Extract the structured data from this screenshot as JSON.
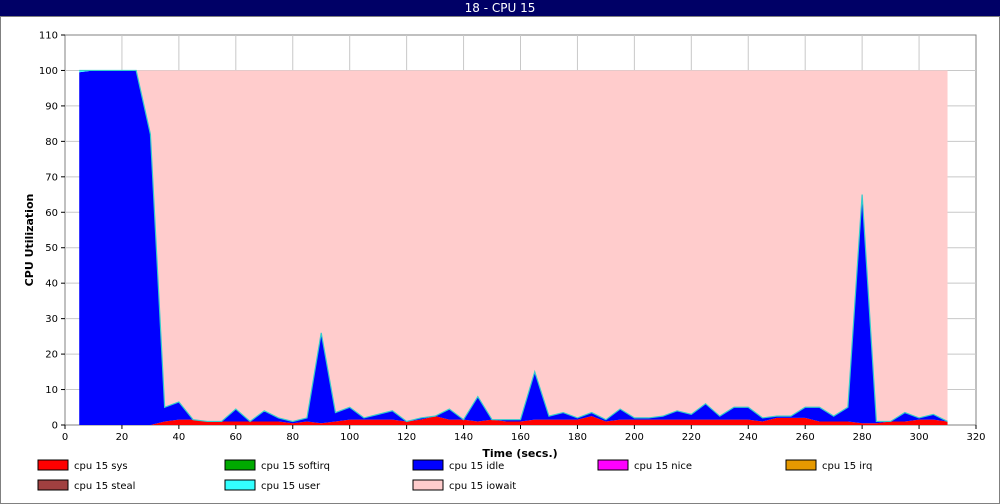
{
  "window_title": "18 - CPU 15",
  "chart_data": {
    "type": "area",
    "stacked": true,
    "title": "18 - CPU 15",
    "xlabel": "Time (secs.)",
    "ylabel": "CPU Utilization",
    "xlim": [
      0,
      320
    ],
    "ylim": [
      0,
      110
    ],
    "xticks": [
      0,
      20,
      40,
      60,
      80,
      100,
      120,
      140,
      160,
      180,
      200,
      220,
      240,
      260,
      280,
      300,
      320
    ],
    "yticks": [
      0,
      10,
      20,
      30,
      40,
      50,
      60,
      70,
      80,
      90,
      100,
      110
    ],
    "grid": true,
    "legend_position": "bottom",
    "x": [
      5,
      10,
      15,
      20,
      25,
      30,
      35,
      40,
      45,
      50,
      55,
      60,
      65,
      70,
      75,
      80,
      85,
      90,
      95,
      100,
      105,
      110,
      115,
      120,
      125,
      130,
      135,
      140,
      145,
      150,
      155,
      160,
      165,
      170,
      175,
      180,
      185,
      190,
      195,
      200,
      205,
      210,
      215,
      220,
      225,
      230,
      235,
      240,
      245,
      250,
      255,
      260,
      265,
      270,
      275,
      280,
      285,
      290,
      295,
      300,
      305,
      310
    ],
    "series": [
      {
        "name": "cpu 15 sys",
        "color": "#ff0000",
        "values": [
          0,
          0,
          0,
          0,
          0,
          0,
          1,
          1.5,
          1.5,
          1,
          1,
          1,
          1,
          1,
          1,
          0.5,
          1,
          0.5,
          1,
          1.5,
          1.5,
          1.5,
          1.5,
          1,
          1.5,
          2.5,
          1.5,
          1.5,
          1,
          1.5,
          1,
          1,
          1.5,
          1.5,
          1.5,
          1.5,
          2.5,
          1,
          1.5,
          1.5,
          1.5,
          1.5,
          1.5,
          1.5,
          1.5,
          1.5,
          1.5,
          1.5,
          1,
          2,
          2,
          2,
          1,
          1,
          1,
          0.5,
          0.5,
          1,
          1,
          1.5,
          1.5,
          1
        ]
      },
      {
        "name": "cpu 15 softirq",
        "color": "#00aa00",
        "values": [
          0,
          0,
          0,
          0,
          0,
          0,
          0,
          0,
          0,
          0,
          0,
          0,
          0,
          0,
          0,
          0,
          0,
          0,
          0,
          0,
          0,
          0,
          0,
          0,
          0,
          0,
          0,
          0,
          0,
          0,
          0,
          0,
          0,
          0,
          0,
          0,
          0,
          0,
          0,
          0,
          0,
          0,
          0,
          0,
          0,
          0,
          0,
          0,
          0,
          0,
          0,
          0,
          0,
          0,
          0,
          0,
          0,
          0,
          0,
          0,
          0,
          0
        ]
      },
      {
        "name": "cpu 15 idle",
        "color": "#0000ff",
        "values": [
          99.5,
          100,
          100,
          100,
          100,
          82,
          4,
          5,
          0,
          0,
          0,
          3.5,
          0,
          3,
          1,
          0.5,
          1,
          25.5,
          2.5,
          3.5,
          0.5,
          1.5,
          2.5,
          0,
          0.5,
          0,
          3,
          0,
          7,
          0,
          0.5,
          0.5,
          13.5,
          1,
          2,
          0.5,
          1,
          0.5,
          3,
          0.5,
          0.5,
          1,
          2.5,
          1.5,
          4.5,
          1,
          3.5,
          3.5,
          1,
          0.5,
          0.5,
          3,
          4,
          1.5,
          4,
          64.5,
          0.5,
          0,
          2.5,
          0.5,
          1.5,
          0
        ]
      },
      {
        "name": "cpu 15 nice",
        "color": "#ff00ff",
        "values": [
          0,
          0,
          0,
          0,
          0,
          0,
          0,
          0,
          0,
          0,
          0,
          0,
          0,
          0,
          0,
          0,
          0,
          0,
          0,
          0,
          0,
          0,
          0,
          0,
          0,
          0,
          0,
          0,
          0,
          0,
          0,
          0,
          0,
          0,
          0,
          0,
          0,
          0,
          0,
          0,
          0,
          0,
          0,
          0,
          0,
          0,
          0,
          0,
          0,
          0,
          0,
          0,
          0,
          0,
          0,
          0,
          0,
          0,
          0,
          0,
          0,
          0
        ]
      },
      {
        "name": "cpu 15 irq",
        "color": "#e69900",
        "values": [
          0,
          0,
          0,
          0,
          0,
          0,
          0,
          0,
          0,
          0,
          0,
          0,
          0,
          0,
          0,
          0,
          0,
          0,
          0,
          0,
          0,
          0,
          0,
          0,
          0,
          0,
          0,
          0,
          0,
          0,
          0,
          0,
          0,
          0,
          0,
          0,
          0,
          0,
          0,
          0,
          0,
          0,
          0,
          0,
          0,
          0,
          0,
          0,
          0,
          0,
          0,
          0,
          0,
          0,
          0,
          0,
          0,
          0,
          0,
          0,
          0,
          0
        ]
      },
      {
        "name": "cpu 15 steal",
        "color": "#a04040",
        "values": [
          0,
          0,
          0,
          0,
          0,
          0,
          0,
          0,
          0,
          0,
          0,
          0,
          0,
          0,
          0,
          0,
          0,
          0,
          0,
          0,
          0,
          0,
          0,
          0,
          0,
          0,
          0,
          0,
          0,
          0,
          0,
          0,
          0,
          0,
          0,
          0,
          0,
          0,
          0,
          0,
          0,
          0,
          0,
          0,
          0,
          0,
          0,
          0,
          0,
          0,
          0,
          0,
          0,
          0,
          0,
          0,
          0,
          0,
          0,
          0,
          0,
          0
        ]
      },
      {
        "name": "cpu 15 user",
        "color": "#33ffff",
        "values": [
          0.5,
          0,
          0,
          0,
          0,
          0,
          0,
          0,
          0,
          0,
          0,
          0,
          0,
          0,
          0,
          0,
          0,
          0,
          0,
          0,
          0,
          0,
          0,
          0,
          0,
          0,
          0,
          0,
          0,
          0,
          0,
          0,
          0,
          0,
          0,
          0,
          0,
          0,
          0,
          0,
          0,
          0,
          0,
          0,
          0,
          0,
          0,
          0,
          0,
          0,
          0,
          0,
          0,
          0,
          0,
          0,
          0,
          0,
          0,
          0,
          0,
          0
        ]
      },
      {
        "name": "cpu 15 iowait",
        "color": "#ffcccc",
        "values": [
          0,
          0,
          0,
          0,
          0,
          18,
          95,
          93.5,
          98.5,
          99,
          99,
          95.5,
          99,
          96,
          98,
          99,
          98,
          74,
          96.5,
          95,
          98,
          97,
          96,
          99,
          98,
          97.5,
          95.5,
          98.5,
          92,
          98.5,
          98.5,
          98.5,
          85,
          97.5,
          96.5,
          98,
          96.5,
          98.5,
          95.5,
          98,
          98,
          97.5,
          96,
          97,
          94,
          97.5,
          95,
          95,
          98,
          97.5,
          97.5,
          95,
          95,
          97.5,
          95,
          35,
          99,
          99,
          96.5,
          98,
          97,
          99
        ]
      }
    ]
  },
  "legend": {
    "items": [
      {
        "label": "cpu 15 sys",
        "color": "#ff0000"
      },
      {
        "label": "cpu 15 softirq",
        "color": "#00aa00"
      },
      {
        "label": "cpu 15 idle",
        "color": "#0000ff"
      },
      {
        "label": "cpu 15 nice",
        "color": "#ff00ff"
      },
      {
        "label": "cpu 15 irq",
        "color": "#e69900"
      },
      {
        "label": "cpu 15 steal",
        "color": "#a04040"
      },
      {
        "label": "cpu 15 user",
        "color": "#33ffff"
      },
      {
        "label": "cpu 15 iowait",
        "color": "#ffcccc"
      }
    ]
  }
}
